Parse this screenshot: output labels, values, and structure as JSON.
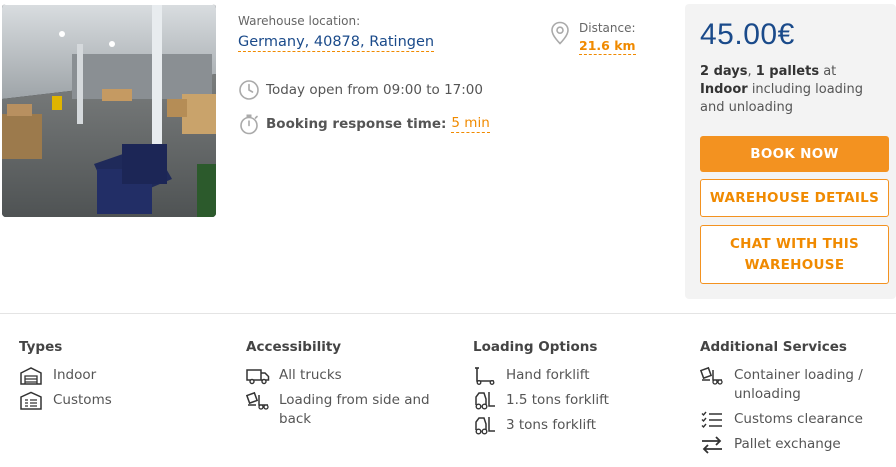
{
  "location": {
    "label": "Warehouse location:",
    "value": "Germany, 40878, Ratingen"
  },
  "hours": {
    "text": "Today open from 09:00 to 17:00"
  },
  "booking": {
    "label": "Booking response time:",
    "value": "5 min"
  },
  "distance": {
    "label": "Distance:",
    "value": "21.6 km"
  },
  "offer": {
    "price": "45.00€",
    "days": "2 days",
    "sep1": ", ",
    "pallets": "1 pallets",
    "at": " at ",
    "type": "Indoor",
    "including": "including loading and unloading",
    "book_now": "BOOK NOW",
    "details": "WAREHOUSE DETAILS",
    "chat": "CHAT WITH THIS WAREHOUSE"
  },
  "features": {
    "types": {
      "title": "Types",
      "items": [
        "Indoor",
        "Customs"
      ]
    },
    "accessibility": {
      "title": "Accessibility",
      "items": [
        "All trucks",
        "Loading from side and back"
      ]
    },
    "loading": {
      "title": "Loading Options",
      "items": [
        "Hand forklift",
        "1.5 tons forklift",
        "3 tons forklift"
      ]
    },
    "services": {
      "title": "Additional Services",
      "items": [
        "Container loading / unloading",
        "Customs clearance",
        "Pallet exchange"
      ]
    }
  },
  "colors": {
    "accent": "#f39220",
    "brand": "#1a4a8a",
    "panel": "#f3f3f3"
  }
}
